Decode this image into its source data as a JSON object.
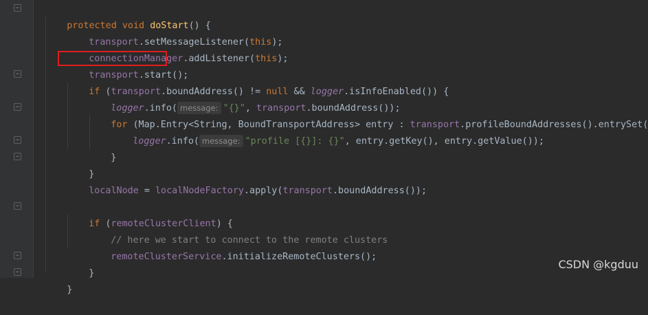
{
  "lines": [
    {
      "p1": "protected void ",
      "fn": "doStart",
      "p2": "() {"
    },
    {
      "obj": "transport",
      "call": ".setMessageListener(",
      "kw": "this",
      "end": ");"
    },
    {
      "obj": "connectionManager",
      "call": ".addListener(",
      "kw": "this",
      "end": ");"
    },
    {
      "obj": "transport",
      "call": ".start();"
    },
    {
      "if": "if",
      "p1": " (",
      "obj": "transport",
      "p2": ".boundAddress() != ",
      "null": "null",
      "p3": " && ",
      "logger": "logger",
      "p4": ".isInfoEnabled()) {"
    },
    {
      "logger": "logger",
      "p1": ".info(",
      "hint": "message:",
      "str": "\"{}\"",
      "p2": ", ",
      "obj": "transport",
      "p3": ".boundAddress());"
    },
    {
      "for": "for",
      "p1": " (Map.Entry<String, BoundTransportAddress> entry : ",
      "obj": "transport",
      "p2": ".profileBoundAddresses().entrySet()) {"
    },
    {
      "logger": "logger",
      "p1": ".info(",
      "hint": "message:",
      "str": "\"profile [{}]: {}\"",
      "p2": ", entry.getKey(), entry.getValue());"
    },
    {
      "text": "}"
    },
    {
      "text": "}"
    },
    {
      "obj1": "localNode",
      "p1": " = ",
      "obj2": "localNodeFactory",
      "p2": ".apply(",
      "obj3": "transport",
      "p3": ".boundAddress());"
    },
    {
      "text": ""
    },
    {
      "if": "if",
      "p1": " (",
      "obj": "remoteClusterClient",
      "p2": ") {"
    },
    {
      "comment": "// here we start to connect to the remote clusters"
    },
    {
      "obj": "remoteClusterService",
      "call": ".initializeRemoteClusters();"
    },
    {
      "text": "}"
    },
    {
      "text": "}"
    }
  ],
  "watermark": "CSDN @kgduu",
  "colors": {
    "background": "#2b2b2b",
    "keyword": "#cc7832",
    "field": "#9876aa",
    "string": "#6a8759",
    "highlight": "#e01e1e"
  }
}
